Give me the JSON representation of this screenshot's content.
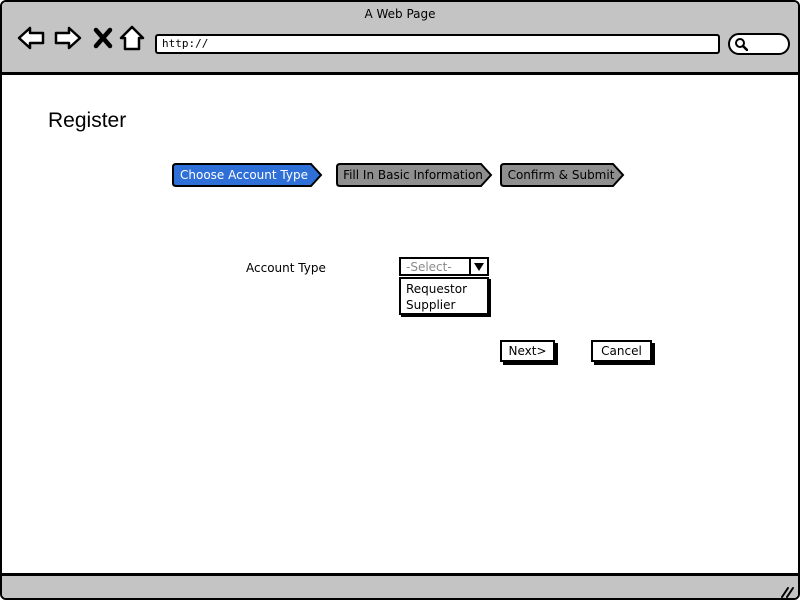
{
  "browser": {
    "window_title": "A Web Page",
    "url": "http://",
    "icons": [
      "back-icon",
      "forward-icon",
      "stop-icon",
      "home-icon",
      "search-icon",
      "resize-grip-icon"
    ]
  },
  "page": {
    "title": "Register"
  },
  "steps": [
    {
      "label": "Choose Account Type",
      "active": true
    },
    {
      "label": "Fill In Basic Information",
      "active": false
    },
    {
      "label": "Confirm & Submit",
      "active": false
    }
  ],
  "form": {
    "account_type_label": "Account Type",
    "account_type_selected": "-Select-",
    "account_type_options": [
      "Requestor",
      "Supplier"
    ],
    "next_label": "Next>",
    "cancel_label": "Cancel"
  },
  "colors": {
    "chrome": "#c4c4c4",
    "active_step": "#2e6fd8",
    "inactive_step": "#8f8f8f"
  }
}
